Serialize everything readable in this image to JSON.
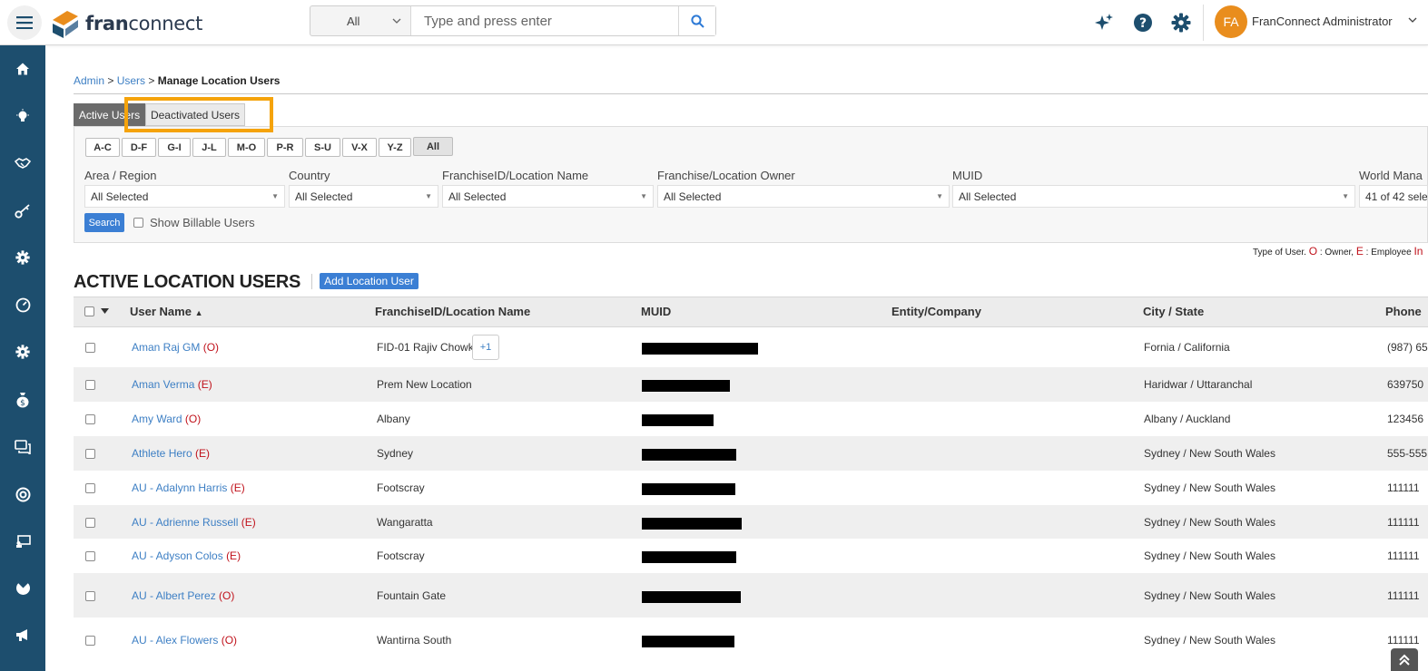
{
  "header": {
    "logo_text_bold": "fran",
    "logo_text_rest": "connect",
    "search_scope": "All",
    "search_placeholder": "Type and press enter",
    "avatar_initials": "FA",
    "user_name": "FranConnect Administrator"
  },
  "breadcrumb": {
    "admin": "Admin",
    "sep1": " > ",
    "users": "Users",
    "sep2": " > ",
    "current": "Manage Location Users"
  },
  "tabs": {
    "active": "Active Users",
    "deactivated": "Deactivated Users"
  },
  "alpha_filters": [
    "A-C",
    "D-F",
    "G-I",
    "J-L",
    "M-O",
    "P-R",
    "S-U",
    "V-X",
    "Y-Z",
    "All"
  ],
  "filters": [
    {
      "label": "Area / Region",
      "value": "All Selected"
    },
    {
      "label": "Country",
      "value": "All Selected"
    },
    {
      "label": "FranchiseID/Location Name",
      "value": "All Selected"
    },
    {
      "label": "Franchise/Location Owner",
      "value": "All Selected"
    },
    {
      "label": "MUID",
      "value": "All Selected"
    },
    {
      "label": "World Mana",
      "value": "41 of 42 sele"
    }
  ],
  "search_button": "Search",
  "billable_label": "Show Billable Users",
  "type_legend": {
    "prefix": "Type of User. ",
    "o": "O",
    "o_text": " : Owner, ",
    "e": "E",
    "e_text": " : Employee ",
    "in": "In"
  },
  "section_title": "ACTIVE LOCATION USERS",
  "add_button": "Add Location User",
  "table": {
    "columns": {
      "user_name": "User Name",
      "sort_indicator": "▲",
      "location": "FranchiseID/Location Name",
      "muid": "MUID",
      "entity": "Entity/Company",
      "city_state": "City / State",
      "phone": "Phone"
    },
    "rows": [
      {
        "name": "Aman Raj GM",
        "type": "(O)",
        "location": "FID-01 Rajiv Chowk",
        "extra": "+1",
        "city": "Fornia / California",
        "phone": "(987) 65"
      },
      {
        "name": "Aman Verma",
        "type": "(E)",
        "location": "Prem New Location",
        "city": "Haridwar / Uttaranchal",
        "phone": "639750"
      },
      {
        "name": "Amy Ward",
        "type": "(O)",
        "location": "Albany",
        "city": "Albany / Auckland",
        "phone": "123456"
      },
      {
        "name": "Athlete Hero",
        "type": "(E)",
        "location": "Sydney",
        "city": "Sydney / New South Wales",
        "phone": "555-555"
      },
      {
        "name": "AU - Adalynn Harris",
        "type": "(E)",
        "location": "Footscray",
        "city": "Sydney / New South Wales",
        "phone": "111111"
      },
      {
        "name": "AU - Adrienne Russell",
        "type": "(E)",
        "location": "Wangaratta",
        "city": "Sydney / New South Wales",
        "phone": "111111"
      },
      {
        "name": "AU - Adyson Colos",
        "type": "(E)",
        "location": "Footscray",
        "city": "Sydney / New South Wales",
        "phone": "111111"
      },
      {
        "name": "AU - Albert Perez",
        "type": "(O)",
        "location": "Fountain Gate",
        "city": "Sydney / New South Wales",
        "phone": "111111"
      },
      {
        "name": "AU - Alex Flowers",
        "type": "(O)",
        "location": "Wantirna South",
        "city": "Sydney / New South Wales",
        "phone": "111111"
      }
    ]
  },
  "colors": {
    "sidebar": "#1d4e6e",
    "link": "#3d7fc4",
    "accent_button": "#3b7fd4",
    "highlight": "#f5a30b",
    "user_type": "#c0121b",
    "avatar": "#e98d1d"
  },
  "icons": {
    "menu": "hamburger-icon",
    "search": "search-icon",
    "sparkle": "sparkle-icon",
    "help": "help-icon",
    "settings": "gear-icon",
    "sidebar": [
      "home-icon",
      "lightbulb-icon",
      "handshake-icon",
      "key-icon",
      "gear-icon",
      "gauge-icon",
      "gear-icon",
      "money-bag-icon",
      "chat-icon",
      "lifebuoy-icon",
      "training-icon",
      "pie-icon",
      "megaphone-icon"
    ]
  }
}
